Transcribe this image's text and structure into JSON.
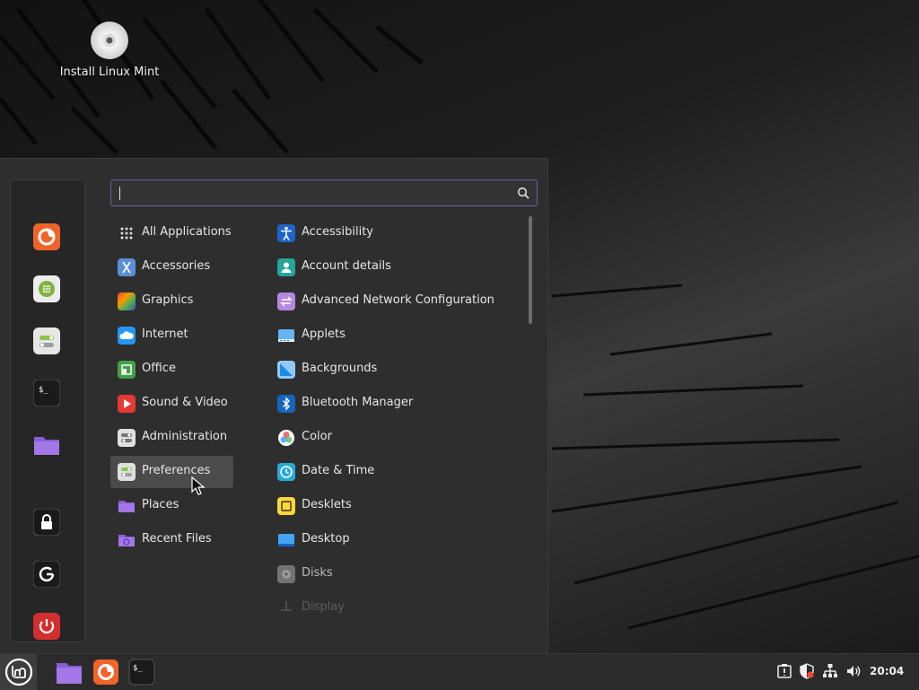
{
  "desktop": {
    "icons": [
      {
        "label": "Install Linux Mint",
        "icon": "disc-icon"
      }
    ]
  },
  "menu": {
    "search": {
      "value": "",
      "placeholder": ""
    },
    "favorites": [
      {
        "name": "firefox",
        "icon": "firefox-icon",
        "color": "#f0642a"
      },
      {
        "name": "software-manager",
        "icon": "software-manager-icon",
        "color": "#8bc34a"
      },
      {
        "name": "system-settings",
        "icon": "settings-icon",
        "color": "#dcdcdc"
      },
      {
        "name": "terminal",
        "icon": "terminal-icon",
        "color": "#1e1e1e"
      },
      {
        "name": "files",
        "icon": "folder-icon",
        "color": "#8a5cd6"
      }
    ],
    "session": [
      {
        "name": "lock-screen",
        "icon": "lock-icon"
      },
      {
        "name": "logout",
        "icon": "logout-icon"
      },
      {
        "name": "shutdown",
        "icon": "power-icon",
        "color": "#d32f2f"
      }
    ],
    "categories": [
      {
        "label": "All Applications",
        "icon": "grid-icon"
      },
      {
        "label": "Accessories",
        "icon": "scissors-icon"
      },
      {
        "label": "Graphics",
        "icon": "graphics-icon"
      },
      {
        "label": "Internet",
        "icon": "cloud-icon"
      },
      {
        "label": "Office",
        "icon": "office-icon"
      },
      {
        "label": "Sound & Video",
        "icon": "play-icon"
      },
      {
        "label": "Administration",
        "icon": "toggles-icon"
      },
      {
        "label": "Preferences",
        "icon": "toggles-icon",
        "selected": true
      },
      {
        "label": "Places",
        "icon": "folder-icon"
      },
      {
        "label": "Recent Files",
        "icon": "recent-folder-icon"
      }
    ],
    "apps": [
      {
        "label": "Accessibility",
        "icon": "accessibility-icon"
      },
      {
        "label": "Account details",
        "icon": "account-icon"
      },
      {
        "label": "Advanced Network Configuration",
        "icon": "network-config-icon"
      },
      {
        "label": "Applets",
        "icon": "applets-icon"
      },
      {
        "label": "Backgrounds",
        "icon": "backgrounds-icon"
      },
      {
        "label": "Bluetooth Manager",
        "icon": "bluetooth-icon"
      },
      {
        "label": "Color",
        "icon": "color-icon"
      },
      {
        "label": "Date & Time",
        "icon": "clock-icon"
      },
      {
        "label": "Desklets",
        "icon": "desklets-icon"
      },
      {
        "label": "Desktop",
        "icon": "desktop-icon"
      },
      {
        "label": "Disks",
        "icon": "disks-icon"
      },
      {
        "label": "Display",
        "icon": "display-icon"
      }
    ]
  },
  "panel": {
    "launchers": [
      {
        "name": "files",
        "icon": "folder-icon"
      },
      {
        "name": "firefox",
        "icon": "firefox-icon"
      },
      {
        "name": "terminal",
        "icon": "terminal-icon"
      }
    ],
    "tray": [
      "notifications-icon",
      "update-shield-icon",
      "network-icon",
      "volume-icon"
    ],
    "clock": "20:04"
  }
}
